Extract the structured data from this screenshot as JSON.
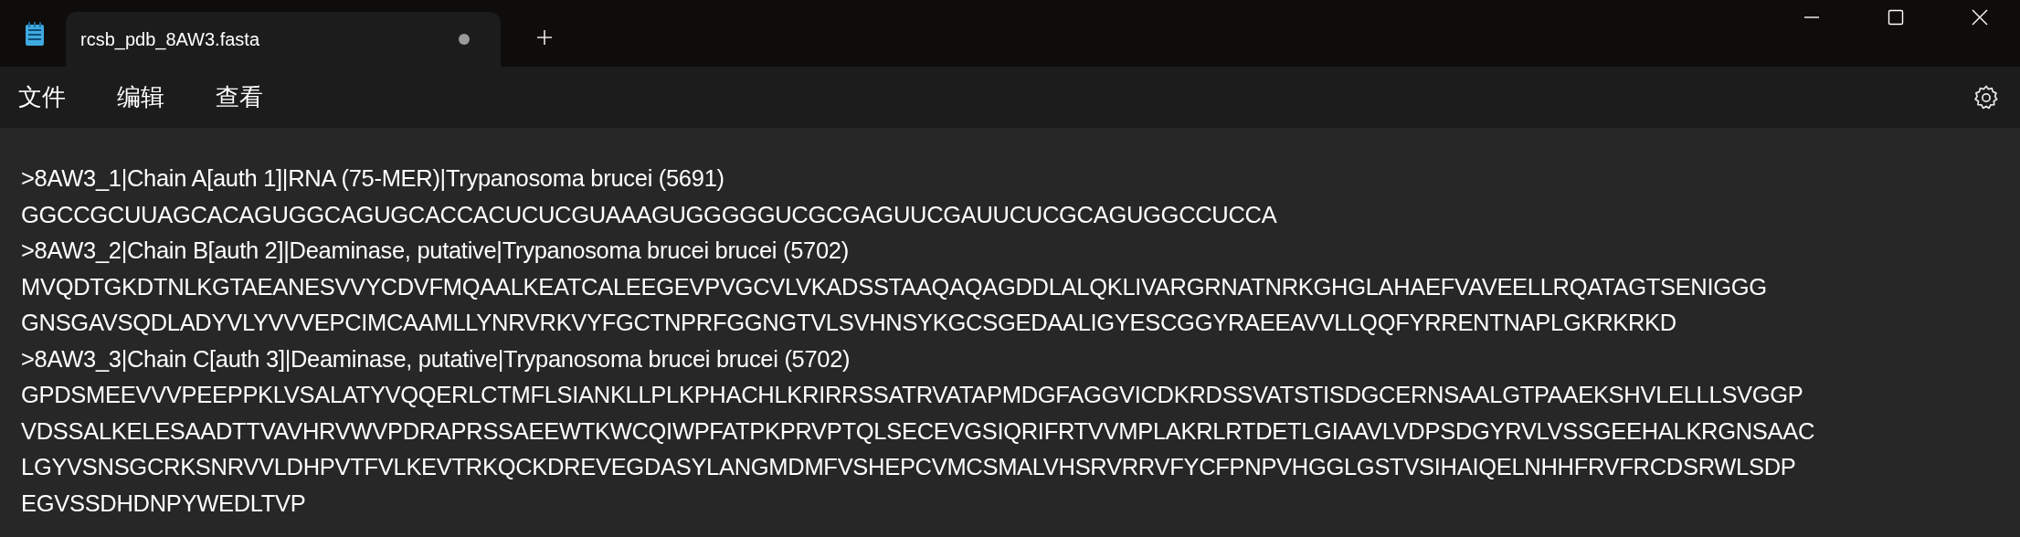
{
  "tabs": [
    {
      "label": "rcsb_pdb_8AW3.fasta",
      "selected": true,
      "modified": true
    }
  ],
  "menu": [
    "文件",
    "编辑",
    "查看"
  ],
  "lines": [
    ">8AW3_1|Chain A[auth 1]|RNA (75-MER)|Trypanosoma brucei (5691)",
    "GGCCGCUUAGCACAGUGGCAGUGCACCACUCUCGUAAAGUGGGGGUCGCGAGUUCGAUUCUCGCAGUGGCCUCCA",
    ">8AW3_2|Chain B[auth 2]|Deaminase, putative|Trypanosoma brucei brucei (5702)",
    "MVQDTGKDTNLKGTAEANESVVYCDVFMQAALKEATCALEEGEVPVGCVLVKADSSTAAQAQAGDDLALQKLIVARGRNATNRKGHGLAHAEFVAVEELLRQATAGTSENIGGG",
    "GNSGAVSQDLADYVLYVVVEPCIMCAAMLLYNRVRKVYFGCTNPRFGGNGTVLSVHNSYKGCSGEDAALIGYESCGGYRAEEAVVLLQQFYRRENTNAPLGKRKRKD",
    ">8AW3_3|Chain C[auth 3]|Deaminase, putative|Trypanosoma brucei brucei (5702)",
    "GPDSMEEVVVPEEPPKLVSALATYVQQERLCTMFLSIANKLLPLKPHACHLKRIRRSSATRVATAPMDGFAGGVICDKRDSSVATSTISDGCERNSAALGTPAAEKSHVLELLLSVGGP",
    "VDSSALKELESAADTTVAVHRVWVPDRAPRSSAEEWTKWCQIWPFATPKPRVPTQLSECEVGSIQRIFRTVVMPLAKRLRTDETLGIAAVLVDPSDGYRVLVSSGEEHALKRGNSAAC",
    "LGYVSNSGCRKSNRVVLDHPVTFVLKEVTRKQCKDREVEGDASYLANGMDMFVSHEPCVMCSMALVHSRVRRVFYCFPNPVHGGLGSTVSIHAIQELNHHFRVFRCDSRWLSDP",
    "EGVSSDHDNPYWEDLTVP"
  ]
}
